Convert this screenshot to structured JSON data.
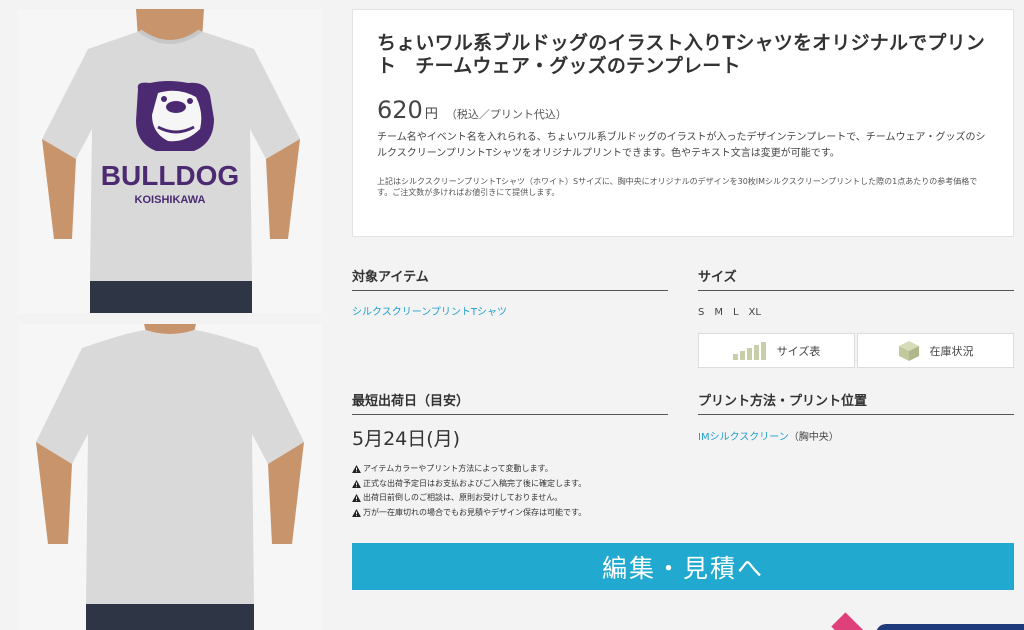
{
  "product": {
    "title": "ちょいワル系ブルドッグのイラスト入りTシャツをオリジナルでプリント　チームウェア・グッズのテンプレート",
    "price": "620",
    "price_unit": "円",
    "price_tax": "（税込／プリント代込）",
    "description": "チーム名やイベント名を入れられる、ちょいワル系ブルドッグのイラストが入ったデザインテンプレートで、チームウェア・グッズのシルクスクリーンプリントTシャツをオリジナルプリントできます。色やテキスト文言は変更が可能です。",
    "price_note": "上記はシルクスクリーンプリントTシャツ（ホワイト）Sサイズに、胸中央にオリジナルのデザインを30枚IMシルクスクリーンプリントした際の1点あたりの参考価格です。ご注文数が多ければお値引きにて提供します。"
  },
  "design": {
    "main_text": "BULLDOG",
    "sub_text": "KOISHIKAWA",
    "ink_color": "#4b2a72"
  },
  "item": {
    "heading": "対象アイテム",
    "link": "シルクスクリーンプリントTシャツ"
  },
  "size": {
    "heading": "サイズ",
    "values": "S　M　L　XL",
    "size_chart_button": "サイズ表",
    "stock_button": "在庫状況"
  },
  "shipping": {
    "heading": "最短出荷日（目安）",
    "date": "5月24日(月)",
    "warnings": [
      "アイテムカラーやプリント方法によって変動します。",
      "正式な出荷予定日はお支払およびご入稿完了後に確定します。",
      "出荷日前倒しのご相談は、原則お受けしておりません。",
      "万が一在庫切れの場合でもお見積やデザイン保存は可能です。"
    ]
  },
  "print": {
    "heading": "プリント方法・プリント位置",
    "method_link": "IMシルクスクリーン",
    "position": "（胸中央）"
  },
  "cta": {
    "label": "編集・見積へ"
  },
  "colors": {
    "accent": "#22a9cf",
    "link": "#1f9fce",
    "design_ink": "#4b2a72"
  }
}
